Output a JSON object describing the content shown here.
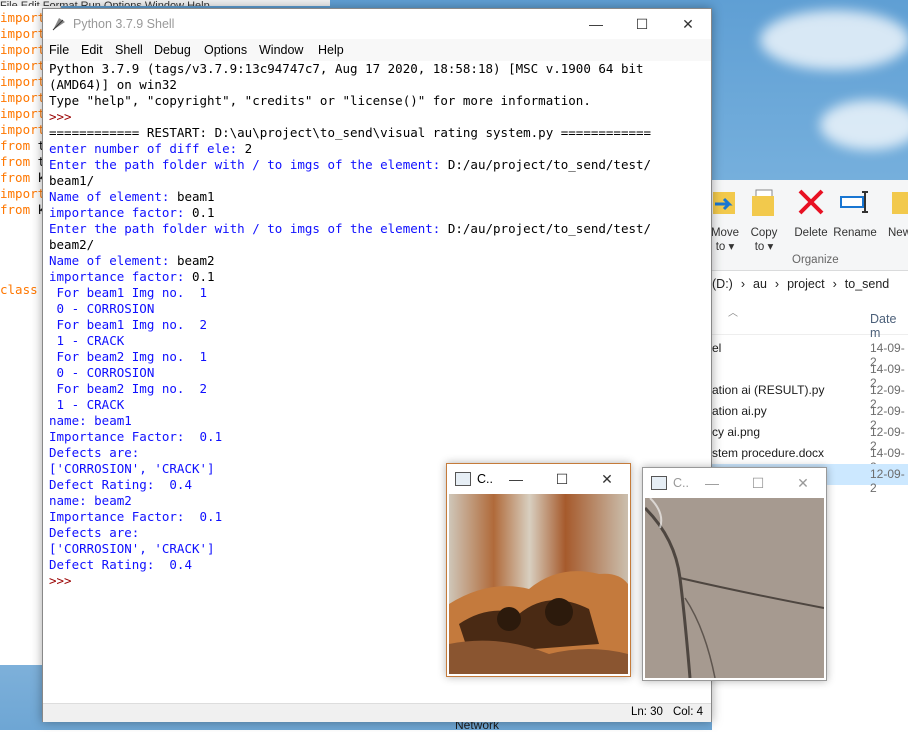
{
  "background_editor": {
    "menu_text": "File  Edit  Format  Run  Options  Window  Help",
    "code_lines": [
      {
        "kw": "import",
        "rest": ""
      },
      {
        "kw": "import",
        "rest": ""
      },
      {
        "kw": "import",
        "rest": ""
      },
      {
        "kw": "import",
        "rest": ""
      },
      {
        "kw": "import",
        "rest": ""
      },
      {
        "kw": "import",
        "rest": ""
      },
      {
        "kw": "import",
        "rest": ""
      },
      {
        "kw": "import",
        "rest": ""
      },
      {
        "kw": "from",
        "rest": " t"
      },
      {
        "kw": "from",
        "rest": " t"
      },
      {
        "kw": "from",
        "rest": " k"
      },
      {
        "kw": "import",
        "rest": ""
      },
      {
        "kw": "from",
        "rest": " k"
      },
      {
        "kw": "",
        "rest": ""
      },
      {
        "kw": "",
        "rest": ""
      },
      {
        "kw": "",
        "rest": ""
      },
      {
        "kw": "",
        "rest": ""
      },
      {
        "kw": "class",
        "rest": ""
      }
    ]
  },
  "shell": {
    "title": "Python 3.7.9 Shell",
    "menu": [
      "File",
      "Edit",
      "Shell",
      "Debug",
      "Options",
      "Window",
      "Help"
    ],
    "lines": [
      {
        "t": "out",
        "s": "Python 3.7.9 (tags/v3.7.9:13c94747c7, Aug 17 2020, 18:58:18) [MSC v.1900 64 bit"
      },
      {
        "t": "out",
        "s": "(AMD64)] on win32"
      },
      {
        "t": "out",
        "s": "Type \"help\", \"copyright\", \"credits\" or \"license()\" for more information."
      },
      {
        "t": "prompt",
        "s": ">>>"
      },
      {
        "t": "out",
        "s": "============ RESTART: D:\\au\\project\\to_send\\visual rating system.py ============"
      },
      {
        "t": "mix",
        "a": "enter number of diff ele: ",
        "b": "2"
      },
      {
        "t": "mix",
        "a": "Enter the path folder with / to imgs of the element: ",
        "b": "D:/au/project/to_send/test/"
      },
      {
        "t": "out",
        "s": "beam1/"
      },
      {
        "t": "mix",
        "a": "Name of element: ",
        "b": "beam1"
      },
      {
        "t": "mix",
        "a": "importance factor: ",
        "b": "0.1"
      },
      {
        "t": "mix",
        "a": "Enter the path folder with / to imgs of the element: ",
        "b": "D:/au/project/to_send/test/"
      },
      {
        "t": "out",
        "s": "beam2/"
      },
      {
        "t": "mix",
        "a": "Name of element: ",
        "b": "beam2"
      },
      {
        "t": "mix",
        "a": "importance factor: ",
        "b": "0.1"
      },
      {
        "t": "in",
        "s": " For beam1 Img no.  1"
      },
      {
        "t": "in",
        "s": " 0 - CORROSION"
      },
      {
        "t": "in",
        "s": " For beam1 Img no.  2"
      },
      {
        "t": "in",
        "s": " 1 - CRACK"
      },
      {
        "t": "in",
        "s": " For beam2 Img no.  1"
      },
      {
        "t": "in",
        "s": " 0 - CORROSION"
      },
      {
        "t": "in",
        "s": " For beam2 Img no.  2"
      },
      {
        "t": "in",
        "s": " 1 - CRACK"
      },
      {
        "t": "in",
        "s": "name: beam1"
      },
      {
        "t": "in",
        "s": "Importance Factor:  0.1"
      },
      {
        "t": "in",
        "s": "Defects are:"
      },
      {
        "t": "in",
        "s": "['CORROSION', 'CRACK']"
      },
      {
        "t": "in",
        "s": "Defect Rating:  0.4"
      },
      {
        "t": "in",
        "s": "name: beam2"
      },
      {
        "t": "in",
        "s": "Importance Factor:  0.1"
      },
      {
        "t": "in",
        "s": "Defects are:"
      },
      {
        "t": "in",
        "s": "['CORROSION', 'CRACK']"
      },
      {
        "t": "in",
        "s": "Defect Rating:  0.4"
      },
      {
        "t": "prompt",
        "s": ">>>"
      }
    ],
    "status": {
      "line": "Ln: 30",
      "col": "Col: 4"
    }
  },
  "explorer": {
    "ribbon": {
      "move_to": "Move to ▾",
      "copy_to": "Copy to ▾",
      "delete": "Delete",
      "rename": "Rename",
      "new_folder": "New fol",
      "group_label": "Organize"
    },
    "address": [
      "(D:)",
      "›",
      "au",
      "›",
      "project",
      "›",
      "to_send"
    ],
    "date_header": "Date m",
    "files": [
      {
        "name": "el",
        "date": "14-09-2"
      },
      {
        "name": "",
        "date": "14-09-2"
      },
      {
        "name": "ation ai (RESULT).py",
        "date": "12-09-2"
      },
      {
        "name": "ation ai.py",
        "date": "12-09-2"
      },
      {
        "name": "cy ai.png",
        "date": "12-09-2"
      },
      {
        "name": "stem procedure.docx",
        "date": "14-09-2"
      },
      {
        "name": "",
        "date": "12-09-2"
      }
    ],
    "network_label": "Network"
  },
  "cv_windows": [
    {
      "title": "C.."
    },
    {
      "title": "C.."
    }
  ],
  "colors": {
    "keyword": "#ff7700",
    "shell_output": "#1010ff",
    "prompt": "#990000",
    "delete_red": "#e81123",
    "selection": "#cce8ff"
  }
}
